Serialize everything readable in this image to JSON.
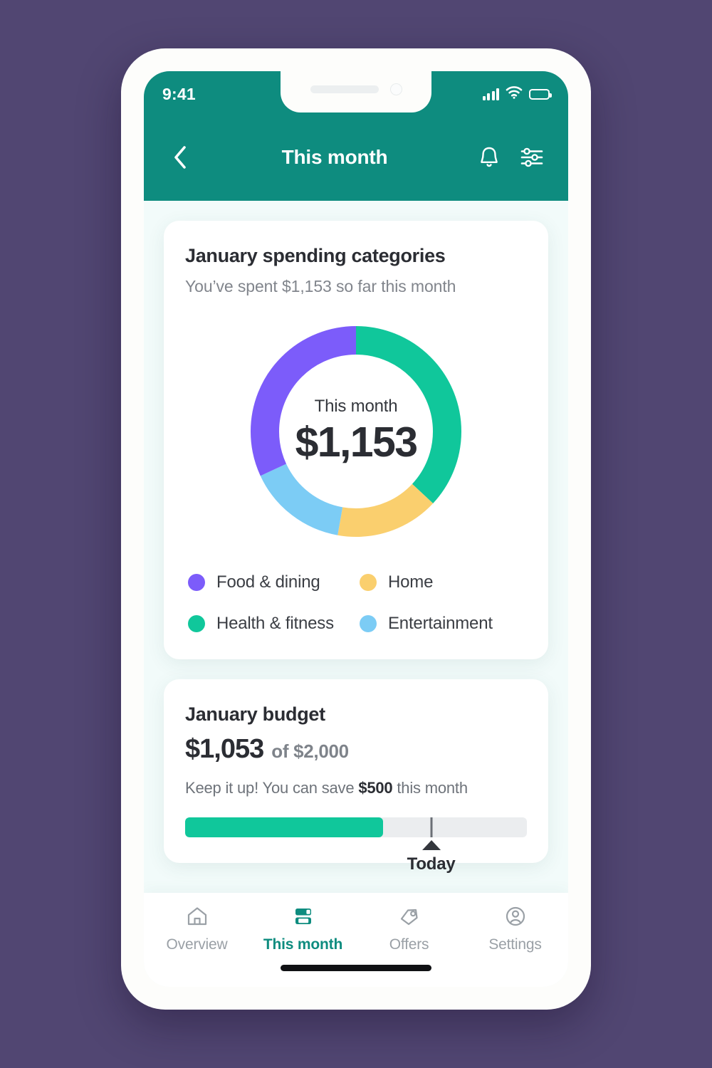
{
  "background_color": "#514672",
  "status_bar": {
    "time": "9:41",
    "signal_icon": "signal-bars-icon",
    "wifi_icon": "wifi-icon",
    "battery_icon": "battery-icon"
  },
  "header": {
    "title": "This month",
    "back_icon": "chevron-left-icon",
    "bell_icon": "bell-icon",
    "filter_icon": "sliders-icon",
    "background_color": "#0E8C7F"
  },
  "spending_card": {
    "title": "January spending categories",
    "subtitle": "You’ve spent $1,153 so far this month",
    "center_label": "This month",
    "center_value": "$1,153",
    "legend": [
      {
        "label": "Food & dining",
        "color": "#7C5CFA"
      },
      {
        "label": "Home",
        "color": "#FACF6E"
      },
      {
        "label": "Health & fitness",
        "color": "#10C79B"
      },
      {
        "label": "Entertainment",
        "color": "#7CCCF5"
      }
    ]
  },
  "budget_card": {
    "title": "January budget",
    "spent": "$1,053",
    "of_total": "of $2,000",
    "note_prefix": "Keep it up! You can save ",
    "note_amount": "$500",
    "note_suffix": " this month",
    "progress_percent": 58,
    "today_percent": 72,
    "today_label": "Today",
    "fill_color": "#10C79B",
    "track_color": "#EBEDEF"
  },
  "bottom_nav": {
    "items": [
      {
        "label": "Overview",
        "icon": "home-icon",
        "active": false
      },
      {
        "label": "This month",
        "icon": "bars-icon",
        "active": true
      },
      {
        "label": "Offers",
        "icon": "offer-tag-icon",
        "active": false
      },
      {
        "label": "Settings",
        "icon": "account-icon",
        "active": false
      }
    ],
    "active_color": "#0E8C7F",
    "inactive_color": "#9AA0A6"
  },
  "chart_data": {
    "type": "pie",
    "title": "January spending categories",
    "subtitle": "You’ve spent $1,153 so far this month",
    "center_label": "This month",
    "center_value": "$1,153",
    "total": 1153,
    "currency": "USD",
    "donut": true,
    "inner_radius_ratio": 0.74,
    "start_angle_deg": 0,
    "direction": "clockwise",
    "legend_position": "below",
    "categories": [
      "Health & fitness",
      "Home",
      "Entertainment",
      "Food & dining"
    ],
    "values": [
      426,
      182,
      176,
      369
    ],
    "percentages": [
      37,
      16,
      15,
      32
    ],
    "sweep_degrees": [
      133,
      57,
      55,
      115
    ],
    "colors": [
      "#10C79B",
      "#FACF6E",
      "#7CCCF5",
      "#7C5CFA"
    ],
    "labels_shown": false
  }
}
